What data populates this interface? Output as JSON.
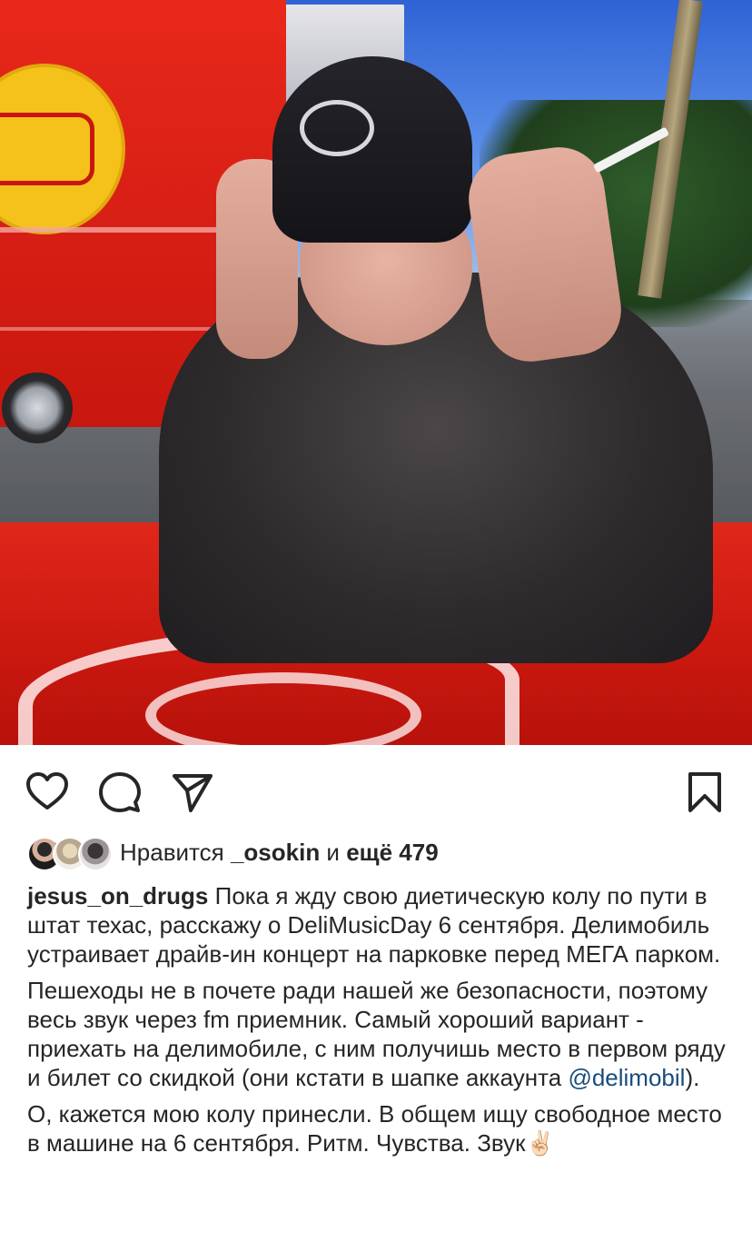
{
  "post": {
    "photo_alt": "",
    "actions": {
      "like_icon": "heart-icon",
      "comment_icon": "comment-icon",
      "share_icon": "send-icon",
      "save_icon": "bookmark-icon"
    },
    "likes": {
      "prefix": "Нравится ",
      "user": "_osokin",
      "middle": " и ",
      "more": "ещё 479"
    },
    "caption": {
      "username": "jesus_on_drugs",
      "paragraph1": " Пока я жду свою диетическую колу по пути в штат техас, расскажу о DeliMusicDay 6 сентября. Делимобиль устраивает драйв-ин концерт на парковке перед МЕГА парком.",
      "paragraph2_before": "Пешеходы не в почете ради нашей же безопасности, поэтому весь звук через fm приемник. Самый хороший вариант - приехать на делимобиле, с ним получишь место в первом ряду и билет со скидкой (они кстати в шапке аккаунта ",
      "mention": "@delimobil",
      "paragraph2_after": ").",
      "paragraph3": "О, кажется мою колу принесли. В общем ищу свободное место в машине на 6 сентября. Ритм. Чувства. Звук✌🏻"
    }
  }
}
